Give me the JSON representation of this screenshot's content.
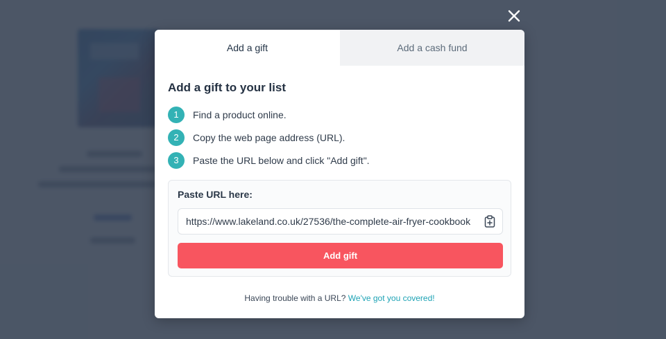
{
  "tabs": [
    {
      "label": "Add a gift",
      "active": true
    },
    {
      "label": "Add a cash fund",
      "active": false
    }
  ],
  "heading": "Add a gift to your list",
  "steps": [
    {
      "number": "1",
      "text": "Find a product online."
    },
    {
      "number": "2",
      "text": "Copy the web page address (URL)."
    },
    {
      "number": "3",
      "text": "Paste the URL below and click \"Add gift\"."
    }
  ],
  "url_panel": {
    "label": "Paste URL here:",
    "value": "https://www.lakeland.co.uk/27536/the-complete-air-fryer-cookbook",
    "paste_icon": "clipboard-plus-icon"
  },
  "add_button": {
    "label": "Add gift"
  },
  "footer": {
    "text": "Having trouble with a URL?",
    "link": "We've got you covered!"
  },
  "close_icon": "close-icon",
  "colors": {
    "accent_teal": "#33b2b5",
    "primary_button": "#f8555f",
    "link": "#1ea3b5",
    "overlay": "#344052"
  }
}
